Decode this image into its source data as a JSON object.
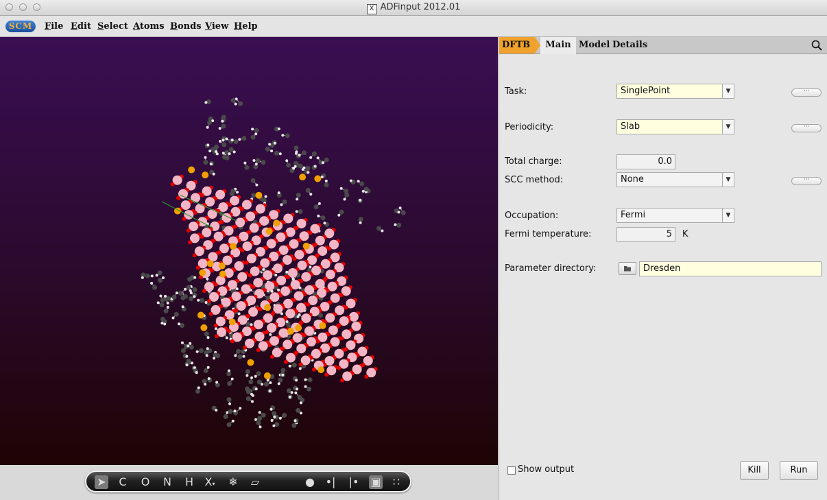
{
  "window": {
    "title": "ADFinput 2012.01"
  },
  "menu": {
    "logo_text": "SCM",
    "items": [
      "File",
      "Edit",
      "Select",
      "Atoms",
      "Bonds",
      "View",
      "Help"
    ]
  },
  "toolbar": {
    "tools": [
      "select-arrow",
      "C",
      "O",
      "N",
      "H",
      "X",
      "freeze",
      "plane",
      "atom-1",
      "atom-2",
      "atom-3",
      "fit-view",
      "clusters"
    ]
  },
  "panel": {
    "tabs": [
      "DFTB",
      "Main",
      "Model",
      "Details"
    ],
    "task": {
      "label": "Task:",
      "value": "SinglePoint"
    },
    "periodicity": {
      "label": "Periodicity:",
      "value": "Slab"
    },
    "total_charge": {
      "label": "Total charge:",
      "value": "0.0"
    },
    "scc_method": {
      "label": "SCC method:",
      "value": "None"
    },
    "occupation": {
      "label": "Occupation:",
      "value": "Fermi"
    },
    "fermi_temperature": {
      "label": "Fermi temperature:",
      "value": "5",
      "unit": "K"
    },
    "parameter_directory": {
      "label": "Parameter directory:",
      "value": "Dresden"
    },
    "more_button": "···",
    "show_output": "Show output",
    "kill": "Kill",
    "run": "Run"
  },
  "colors": {
    "accent_tab": "#f0a22d",
    "combo_bg": "#ffffe0",
    "oxygen": "#e00000",
    "carbon": "#4a4a4a",
    "surface_atom": "#f2b6c6",
    "metal": "#f0a000"
  }
}
